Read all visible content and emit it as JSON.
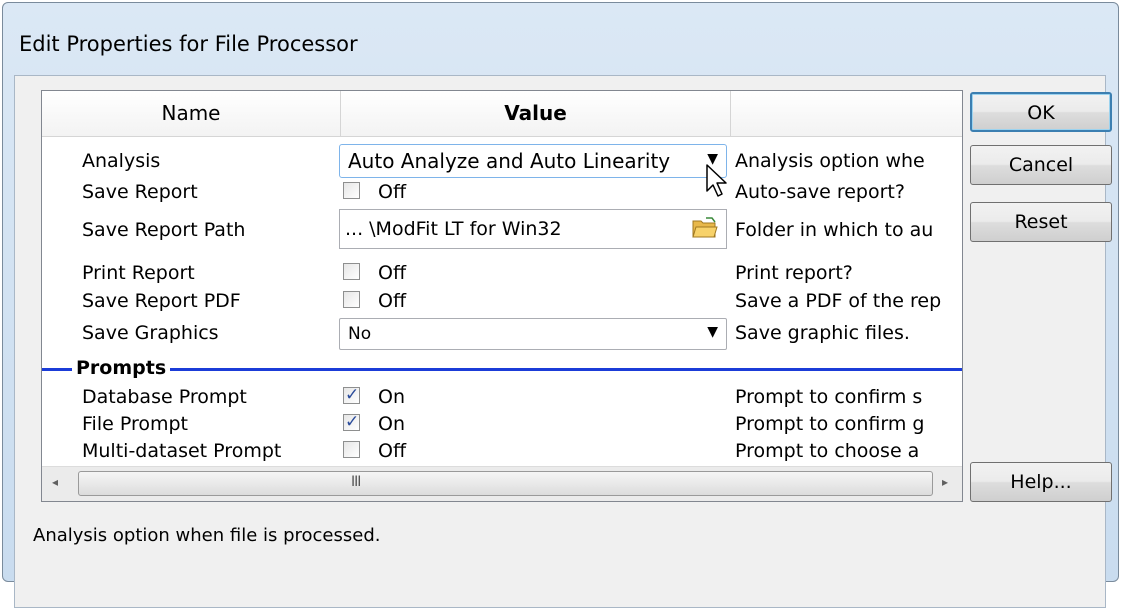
{
  "window": {
    "title": "Edit Properties for File Processor"
  },
  "columns": {
    "name": "Name",
    "value": "Value",
    "description": ""
  },
  "rows": [
    {
      "name": "Analysis",
      "type": "combo",
      "value": "Auto Analyze and Auto Linearity",
      "description": "Analysis option whe"
    },
    {
      "name": "Save Report",
      "type": "checkbox",
      "checked": false,
      "value": "Off",
      "description": "Auto-save report?"
    },
    {
      "name": "Save Report Path",
      "type": "path",
      "value": "... \\ModFit LT for Win32",
      "description": "Folder in which to au"
    },
    {
      "name": "Print Report",
      "type": "checkbox",
      "checked": false,
      "value": "Off",
      "description": "Print report?"
    },
    {
      "name": "Save Report PDF",
      "type": "checkbox",
      "checked": false,
      "value": "Off",
      "description": "Save a PDF of the rep"
    },
    {
      "name": "Save Graphics",
      "type": "combo",
      "value": "No",
      "description": "Save graphic files."
    }
  ],
  "section": {
    "label": "Prompts"
  },
  "prompt_rows": [
    {
      "name": "Database Prompt",
      "type": "checkbox",
      "checked": true,
      "value": "On",
      "description": "Prompt to confirm s"
    },
    {
      "name": "File Prompt",
      "type": "checkbox",
      "checked": true,
      "value": "On",
      "description": "Prompt to confirm g"
    },
    {
      "name": "Multi-dataset Prompt",
      "type": "checkbox",
      "checked": false,
      "value": "Off",
      "description": "Prompt to choose a"
    }
  ],
  "scrollbar": {
    "left_arrow": "◂",
    "right_arrow": "▸",
    "grip": "III"
  },
  "buttons": {
    "ok": "OK",
    "cancel": "Cancel",
    "reset": "Reset",
    "help": "Help..."
  },
  "status": {
    "text": "Analysis option when file is processed."
  },
  "icons": {
    "dropdown": "chevron-down-icon",
    "folder": "folder-open-icon",
    "check": "checkmark-icon"
  },
  "colors": {
    "section_line": "#1b3cd8",
    "focus_border": "#7eb4ea",
    "window_bg": "#c9dcef"
  }
}
